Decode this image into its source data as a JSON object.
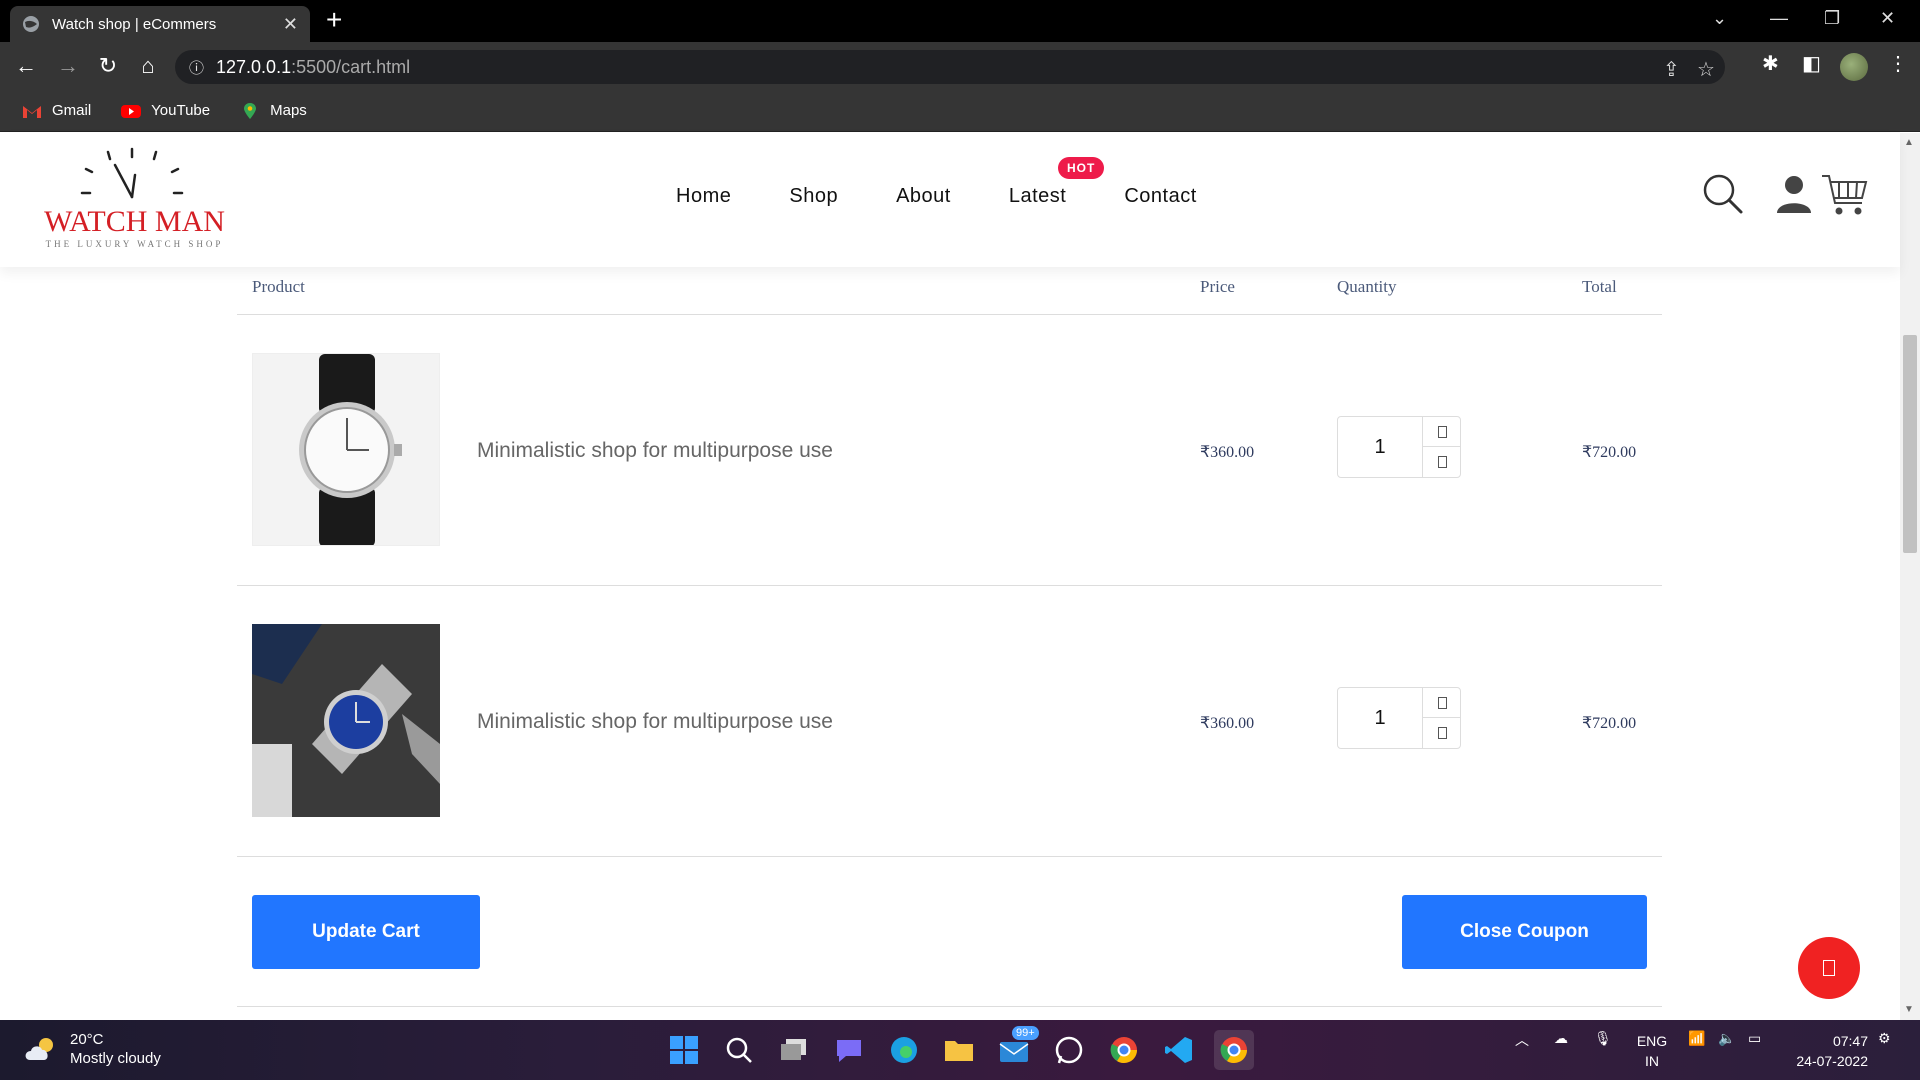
{
  "browser": {
    "tab_title": "Watch shop | eCommers",
    "tab_close": "✕",
    "new_tab": "+",
    "url_host": "127.0.0.1",
    "url_path": ":5500/cart.html",
    "bookmarks": [
      {
        "label": "Gmail",
        "icon": "gmail-icon"
      },
      {
        "label": "YouTube",
        "icon": "youtube-icon"
      },
      {
        "label": "Maps",
        "icon": "maps-icon"
      }
    ]
  },
  "site": {
    "logo_text": "WATCH MAN",
    "logo_tagline": "THE LUXURY WATCH SHOP",
    "nav": [
      "Home",
      "Shop",
      "About",
      "Latest",
      "Contact"
    ],
    "hot_badge": "HOT"
  },
  "cart": {
    "headers": {
      "product": "Product",
      "price": "Price",
      "quantity": "Quantity",
      "total": "Total"
    },
    "items": [
      {
        "name": "Minimalistic shop for multipurpose use",
        "price": "₹360.00",
        "quantity": "1",
        "total": "₹720.00"
      },
      {
        "name": "Minimalistic shop for multipurpose use",
        "price": "₹360.00",
        "quantity": "1",
        "total": "₹720.00"
      }
    ],
    "update_button": "Update Cart",
    "coupon_button": "Close Coupon"
  },
  "taskbar": {
    "temperature": "20°C",
    "weather": "Mostly cloudy",
    "notification_count": "99+",
    "lang_top": "ENG",
    "lang_bottom": "IN",
    "time": "07:47",
    "date": "24-07-2022"
  },
  "colors": {
    "accent_blue": "#2176ff",
    "logo_red": "#d41f25",
    "hot_badge": "#ee1b4a",
    "fab_red": "#f02222"
  }
}
